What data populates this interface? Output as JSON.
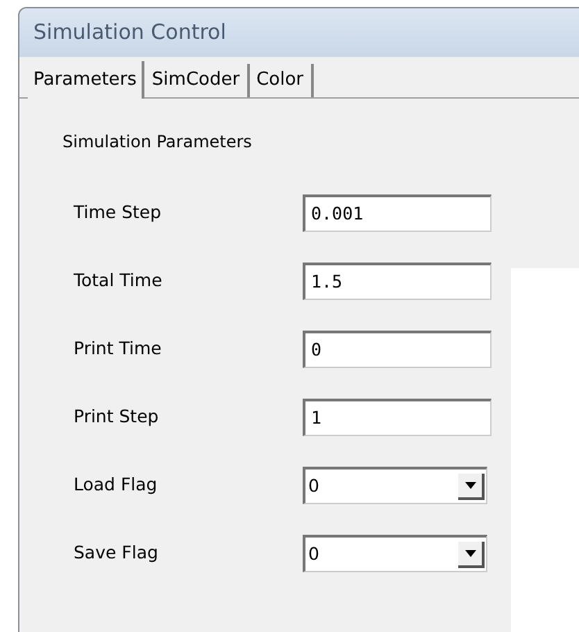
{
  "window": {
    "title": "Simulation Control"
  },
  "tabs": [
    {
      "label": "Parameters",
      "selected": true
    },
    {
      "label": "SimCoder",
      "selected": false
    },
    {
      "label": "Color",
      "selected": false
    }
  ],
  "group": {
    "title": "Simulation Parameters"
  },
  "fields": [
    {
      "label": "Time Step",
      "kind": "text",
      "value": "0.001"
    },
    {
      "label": "Total Time",
      "kind": "text",
      "value": "1.5"
    },
    {
      "label": "Print Time",
      "kind": "text",
      "value": "0"
    },
    {
      "label": "Print Step",
      "kind": "text",
      "value": "1"
    },
    {
      "label": "Load Flag",
      "kind": "dropdown",
      "value": "0"
    },
    {
      "label": "Save Flag",
      "kind": "dropdown",
      "value": "0"
    }
  ]
}
